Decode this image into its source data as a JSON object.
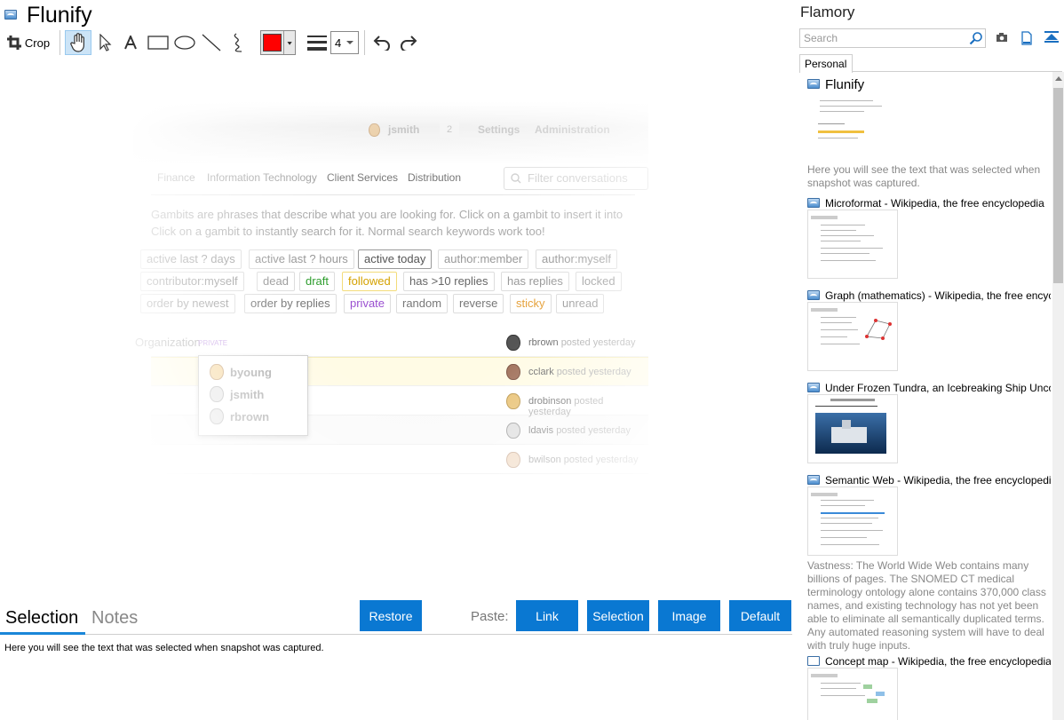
{
  "app": {
    "title": "Flunify"
  },
  "toolbar": {
    "crop_label": "Crop",
    "color": "#ff0000",
    "line_width": "4"
  },
  "screenshot": {
    "user": "jsmith",
    "badge": "2",
    "nav_settings": "Settings",
    "nav_admin": "Administration",
    "channels": [
      "Finance",
      "Information Technology",
      "Client Services",
      "Distribution"
    ],
    "filter_placeholder": "Filter conversations",
    "help_line1": "Gambits are phrases that describe what you are looking for. Click on a gambit to insert it into",
    "help_line2": "Click on a gambit to instantly search for it. Normal search keywords work too!",
    "gambits_row1": [
      "active last ? days",
      "active last ? hours",
      "active today",
      "author:member",
      "author:myself"
    ],
    "gambits_row2": [
      "contributor:myself",
      "dead",
      "draft",
      "followed",
      "has >10 replies",
      "has replies",
      "locked"
    ],
    "gambits_row3": [
      "order by newest",
      "order by replies",
      "private",
      "random",
      "reverse",
      "sticky",
      "unread"
    ],
    "conv_title": "Organization",
    "private_label": "PRIVATE",
    "posts": [
      {
        "user": "rbrown",
        "text": "posted yesterday"
      },
      {
        "user": "cclark",
        "text": "posted yesterday"
      },
      {
        "user": "drobinson",
        "text": "posted yesterday"
      },
      {
        "user": "ldavis",
        "text": "posted yesterday"
      },
      {
        "user": "bwilson",
        "text": "posted yesterday"
      }
    ],
    "popup_users": [
      "byoung",
      "jsmith",
      "rbrown"
    ]
  },
  "bottom": {
    "tab_selection": "Selection",
    "tab_notes": "Notes",
    "restore": "Restore",
    "paste_label": "Paste:",
    "paste_link": "Link",
    "paste_selection": "Selection",
    "paste_image": "Image",
    "paste_default": "Default",
    "selection_text": "Here you will see the text that was selected when snapshot was captured."
  },
  "right": {
    "title": "Flamory",
    "search_placeholder": "Search",
    "tab_personal": "Personal",
    "items": [
      {
        "title": "Flunify",
        "desc": "Here you will see the text that was selected when snapshot was captured."
      },
      {
        "title": "Microformat - Wikipedia, the free encyclopedia"
      },
      {
        "title": "Graph (mathematics) - Wikipedia, the free encyclopedia"
      },
      {
        "title": "Under Frozen Tundra, an Icebreaking Ship Uncovers"
      },
      {
        "title": "Semantic Web - Wikipedia, the free encyclopedia",
        "desc": "Vastness: The World Wide Web contains many billions of pages. The SNOMED CT medical terminology ontology alone contains 370,000 class names, and existing technology has not yet been able to eliminate all semantically duplicated terms. Any automated reasoning system will have to deal with truly huge inputs."
      },
      {
        "title": "Concept map - Wikipedia, the free encyclopedia"
      }
    ]
  },
  "colors": {
    "accent": "#0a78d2",
    "draft": "#2e9d2e",
    "followed": "#d4a100",
    "private": "#9a4fd0",
    "sticky": "#e6a23c"
  }
}
